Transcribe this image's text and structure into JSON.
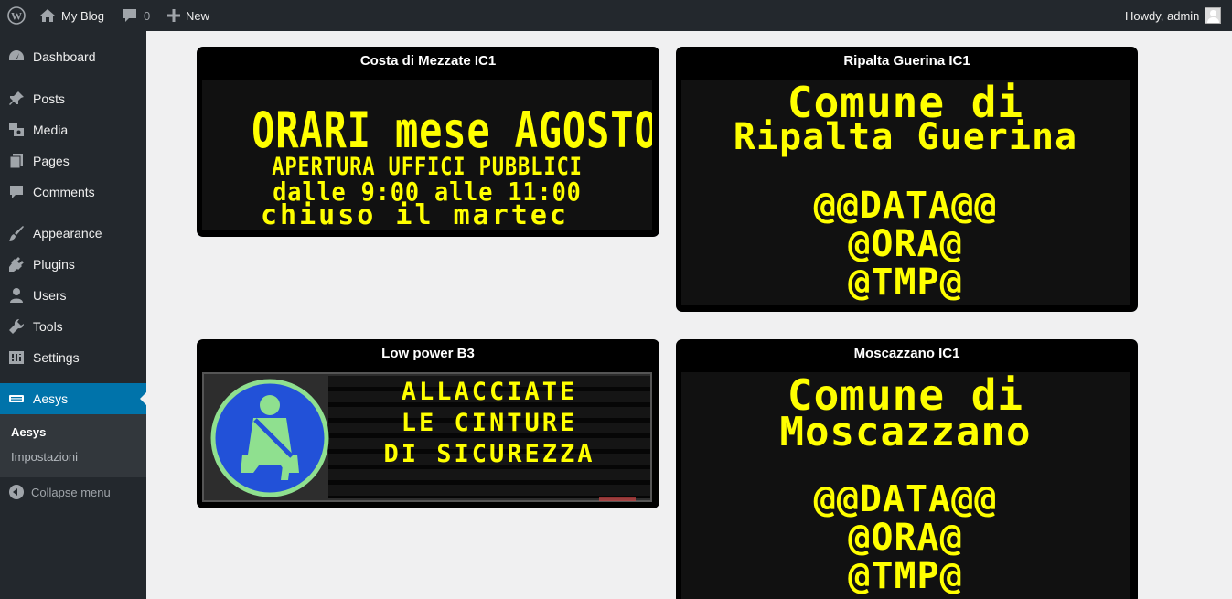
{
  "adminbar": {
    "site_name": "My Blog",
    "comments_count": "0",
    "new_label": "New",
    "greeting": "Howdy, admin"
  },
  "sidebar": {
    "items": [
      {
        "label": "Dashboard",
        "icon": "dashboard-icon"
      },
      {
        "label": "Posts",
        "icon": "pin-icon"
      },
      {
        "label": "Media",
        "icon": "media-icon"
      },
      {
        "label": "Pages",
        "icon": "pages-icon"
      },
      {
        "label": "Comments",
        "icon": "comment-icon"
      },
      {
        "label": "Appearance",
        "icon": "brush-icon"
      },
      {
        "label": "Plugins",
        "icon": "plug-icon"
      },
      {
        "label": "Users",
        "icon": "user-icon"
      },
      {
        "label": "Tools",
        "icon": "wrench-icon"
      },
      {
        "label": "Settings",
        "icon": "settings-icon"
      },
      {
        "label": "Aesys",
        "icon": "aesys-icon"
      }
    ],
    "submenu": [
      "Aesys",
      "Impostazioni"
    ],
    "collapse_label": "Collapse menu"
  },
  "panels": [
    {
      "title": "Costa di Mezzate IC1",
      "lines": [
        "ORARI mese AGOSTO",
        "APERTURA UFFICI PUBBLICI",
        "dalle 9:00 alle 11:00",
        "chiuso il martec"
      ]
    },
    {
      "title": "Ripalta Guerina IC1",
      "lines": [
        "Comune di",
        "Ripalta Guerina",
        "",
        "@@DATA@@",
        "@ORA@",
        "@TMP@"
      ]
    },
    {
      "title": "Low power B3",
      "lines": [
        "ALLACCIATE",
        "LE CINTURE",
        "DI SICUREZZA"
      ]
    },
    {
      "title": "Moscazzano IC1",
      "lines": [
        "Comune di",
        "Moscazzano",
        "",
        "@@DATA@@",
        "@ORA@",
        "@TMP@"
      ]
    }
  ],
  "colors": {
    "adminbar_bg": "#23282d",
    "sidebar_active": "#0073aa",
    "led_text": "#ffff00",
    "content_bg": "#f0f0f1"
  }
}
